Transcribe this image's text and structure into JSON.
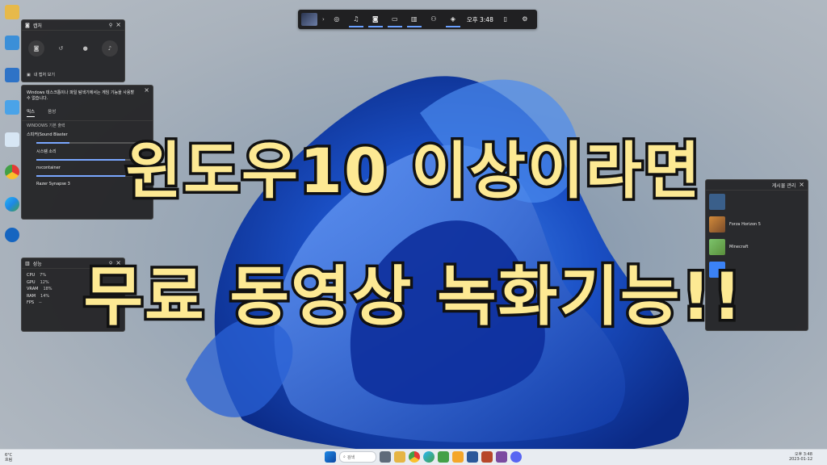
{
  "headline": {
    "line1": "윈도우10 이상이라면",
    "line2": "무료 동영상 녹화기능!!"
  },
  "gamebar": {
    "time": "오후 3:48"
  },
  "capture_panel": {
    "title": "캡처",
    "link": "내 캡처 보기"
  },
  "audio_panel": {
    "note": "Windows 데스크톱이나 파일 탐색기에서는 게임 기능을 사용할 수 없습니다.",
    "tabs": [
      "믹스",
      "음성"
    ],
    "default_output_label": "WINDOWS 기본 출력",
    "default_device": "스피커(Sound Blaster",
    "system_sound": "시스템 소리",
    "apps": [
      "nvcontainer",
      "Razer Synapse 3"
    ]
  },
  "perf_panel": {
    "title": "성능",
    "rows": [
      {
        "name": "CPU",
        "value": "7%"
      },
      {
        "name": "GPU",
        "value": "12%"
      },
      {
        "name": "VRAM",
        "value": "18%"
      },
      {
        "name": "RAM",
        "value": "14%"
      },
      {
        "name": "FPS",
        "value": "--"
      }
    ]
  },
  "games_panel": {
    "title_fragment": "게시물 관리",
    "games": [
      "Forza Horizon 5",
      "Minecraft"
    ]
  },
  "taskbar": {
    "weather_temp": "6°C",
    "weather_desc": "흐림",
    "search": "검색",
    "clock_time": "오후 3:48",
    "clock_date": "2023-01-12"
  },
  "colors": {
    "headline_fill": "#fde993",
    "headline_stroke": "#111111",
    "gamebar_accent": "#6aa0ff"
  }
}
